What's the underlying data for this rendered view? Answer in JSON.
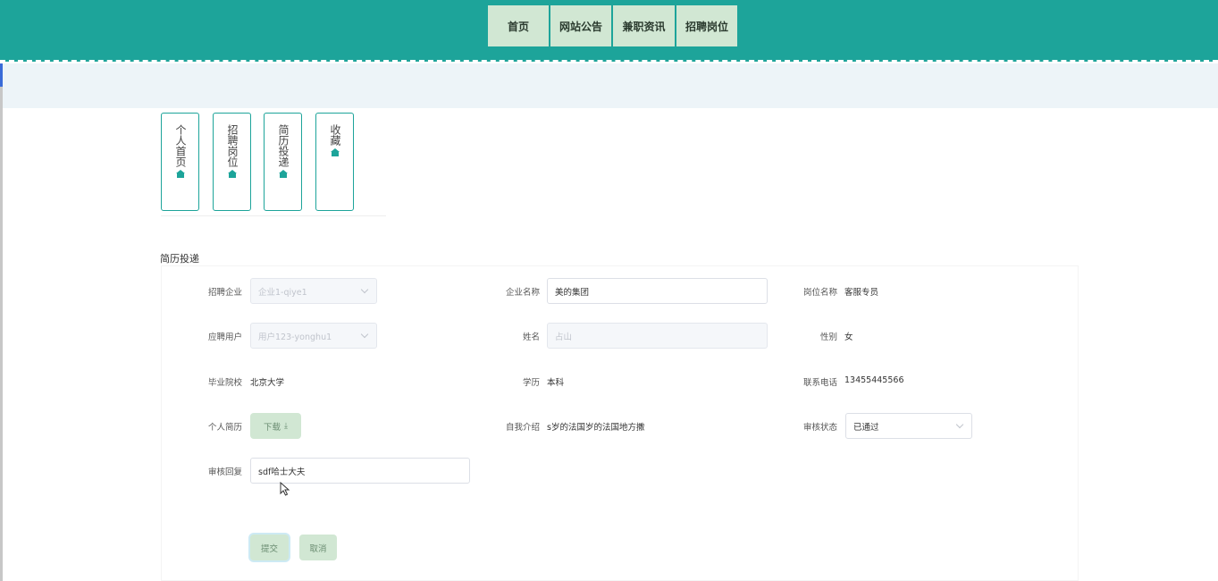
{
  "nav": {
    "items": [
      {
        "label": "首页"
      },
      {
        "label": "网站公告"
      },
      {
        "label": "兼职资讯"
      },
      {
        "label": "招聘岗位"
      }
    ]
  },
  "side_menu": [
    {
      "label": "个人首页",
      "icon": "home-icon"
    },
    {
      "label": "招聘岗位",
      "icon": "home-icon"
    },
    {
      "label": "简历投递",
      "icon": "home-icon"
    },
    {
      "label": "收藏",
      "icon": "home-icon"
    }
  ],
  "section_title": "简历投递",
  "form": {
    "company_label": "招聘企业",
    "company_value": "企业1-qiye1",
    "company_name_label": "企业名称",
    "company_name_value": "美的集团",
    "job_name_label": "岗位名称",
    "job_name_value": "客服专员",
    "applicant_label": "应聘用户",
    "applicant_value": "用户123-yonghu1",
    "name_label": "姓名",
    "name_value": "占山",
    "gender_label": "性别",
    "gender_value": "女",
    "school_label": "毕业院校",
    "school_value": "北京大学",
    "education_label": "学历",
    "education_value": "本科",
    "phone_label": "联系电话",
    "phone_value": "13455445566",
    "resume_label": "个人简历",
    "download_label": "下载",
    "intro_label": "自我介绍",
    "intro_value": "s岁的法国岁的法国地方撒",
    "status_label": "审核状态",
    "status_value": "已通过",
    "reply_label": "审核回复",
    "reply_value": "sdf哈士大夫",
    "submit_label": "提交",
    "cancel_label": "取消"
  },
  "colors": {
    "header_bg": "#1da49a",
    "nav_item_bg": "#d1e7d3",
    "accent": "#1da49a",
    "button_bg": "#d1e7d3"
  }
}
